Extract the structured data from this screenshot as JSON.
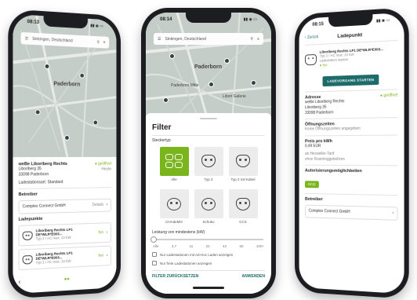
{
  "colors": {
    "accent": "#7ab51d",
    "teal": "#1d6b6a",
    "map": "#c5cdc9"
  },
  "left": {
    "status_time": "08:13",
    "search_placeholder": "Sinkingen, Deutschland",
    "map_label": "Paderborn",
    "address": {
      "line1": "weBe Liboriberg Rechts",
      "line2": "Liboriberg 35",
      "line3": "33098 Paderborn"
    },
    "status_label": "geöffnet",
    "status_sub": "Heute",
    "station_type": "Ladestationsart: Standard",
    "operator_heading": "Betreiber",
    "operator_name": "Complex Connect GmbH",
    "operator_action": "Details",
    "points_heading": "Ladepunkte",
    "points": [
      {
        "name": "Liboriberg Rechts LP1 DE*WLR*E003...",
        "detail": "Typ 2 / AC max. 22 kW",
        "status": "frei"
      },
      {
        "name": "Liboriberg Rechts LP1 DE*WLR*E003...",
        "detail": "Typ 2 / AC max. 22 kW",
        "status": "frei"
      }
    ]
  },
  "center": {
    "status_time": "08:14",
    "search_placeholder": "Sinkingen, Deutschland",
    "map_label": "Paderborn",
    "map_small_labels": [
      "Paderborn Mitte",
      "Libori Galerie"
    ],
    "filter_title": "Filter",
    "plug_heading": "Steckertyp",
    "tiles": [
      {
        "label": "Alle",
        "active": true
      },
      {
        "label": "Typ 2",
        "active": false
      },
      {
        "label": "Typ 2 mit Kabel",
        "active": false
      },
      {
        "label": "CHAdeMO",
        "active": false
      },
      {
        "label": "Schuko",
        "active": false
      },
      {
        "label": "CCS",
        "active": false
      }
    ],
    "power_heading": "Leistung von mindestens (kW)",
    "power_value_fraction": 0.0,
    "ticks": [
      "Alle",
      "3,7",
      "11",
      "22",
      "43",
      "50",
      "100+"
    ],
    "check1": "Nur Ladestationen mit Ad-Hoc Laden anzeigen",
    "check2": "Nur freie Ladestationen anzeigen",
    "reset": "FILTER ZURÜCKSETZEN",
    "apply": "ANWENDEN"
  },
  "right": {
    "status_time": "08:15",
    "back": "Zurück",
    "title": "Ladepunkt",
    "point_name": "Liboriberg Rechts LP1 DE*WLR*E003...",
    "point_detail": "Typ 2 / AC max. 22 kW",
    "point_detail2": "Ladestation starten",
    "point_status": "frei",
    "start_button": "LADEVORGANG STARTEN",
    "address_heading": "Adresse",
    "address_lines": [
      "weBe Liboriberg Rechts",
      "Liboriberg 35",
      "33098 Paderborn"
    ],
    "open_label": "geöffnet",
    "hours_heading": "Öffnungszeiten",
    "hours_text": "Keine Öffnungszeiten angegeben",
    "price_heading": "Preis pro kWh",
    "price_value": "0,49 EUR",
    "price_note1": "ab Hersteller-Tarif",
    "price_note2": "ohne Roaminggebühren",
    "auth_heading": "Autorisierungsmöglichkeiten",
    "auth_chip": "RFID",
    "operator_heading": "Betreiber",
    "operator_name": "Complex Connect GmbH"
  }
}
